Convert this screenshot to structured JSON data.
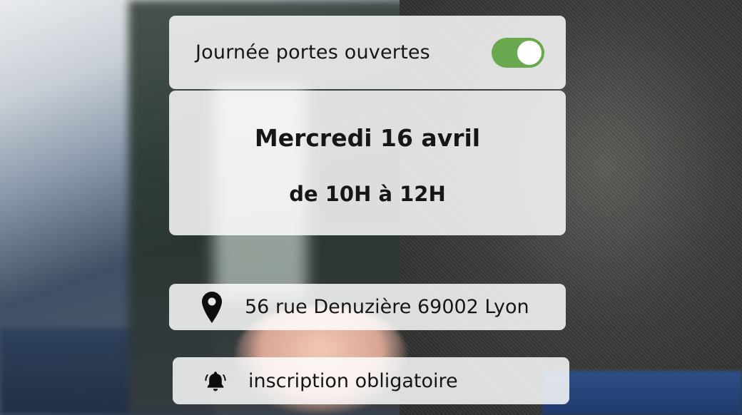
{
  "toggle_card": {
    "label": "Journée portes ouvertes",
    "toggle_on": true,
    "toggle_color": "#6aa84f"
  },
  "event": {
    "date": "Mercredi 16 avril",
    "time": "de 10H à 12H"
  },
  "address": {
    "icon": "location-pin-icon",
    "text": "56 rue Denuzière 69002 Lyon"
  },
  "registration": {
    "icon": "bell-icon",
    "text": "inscription obligatoire"
  }
}
